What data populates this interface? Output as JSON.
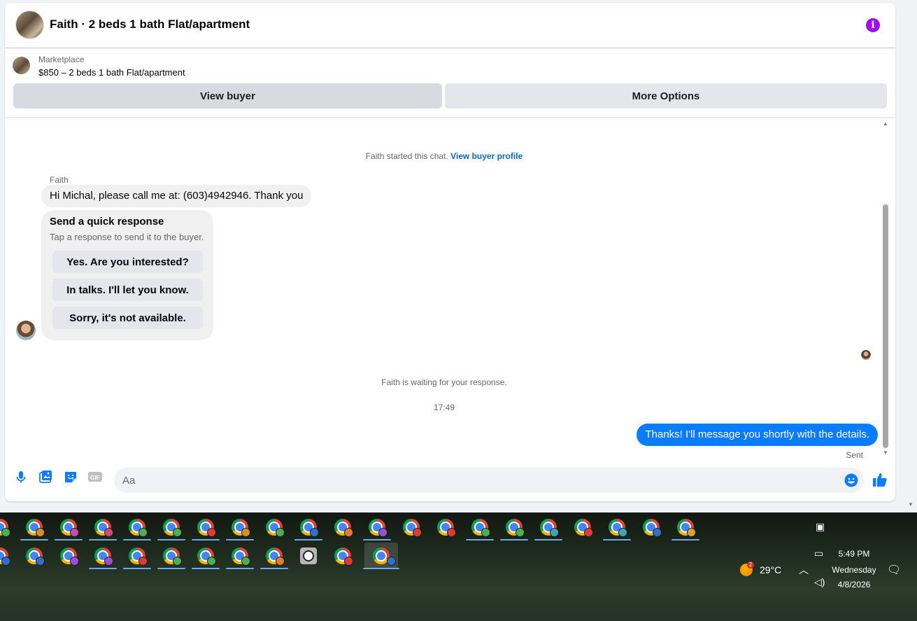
{
  "chat": {
    "title": "Faith · 2 beds 1 bath Flat/apartment",
    "listing_label": "Marketplace",
    "listing_price_title": "$850 – 2 beds 1 bath Flat/apartment",
    "view_buyer_label": "View buyer",
    "more_options_label": "More Options",
    "started_text": "Faith started this chat.",
    "view_profile_link": "View buyer profile",
    "sender_name": "Faith",
    "incoming_message": "Hi Michal, please call me at: (603)4942946. Thank you",
    "quick_response": {
      "title": "Send a quick response",
      "subtitle": "Tap a response to send it to the buyer.",
      "options": [
        "Yes. Are you interested?",
        "In talks. I'll let you know.",
        "Sorry, it's not available."
      ]
    },
    "waiting_text": "Faith is waiting for your response.",
    "timestamp": "17:49",
    "outgoing_message": "Thanks! I'll message you shortly with the details.",
    "sent_status": "Sent",
    "composer_placeholder": "Aa",
    "gif_label": "GIF"
  },
  "taskbar": {
    "weather_temp": "29°C",
    "weather_badge": "2",
    "time": "5:49 PM",
    "day": "Wednesday",
    "date": "4/8/2026"
  },
  "colors": {
    "accent_blue": "#0a7cff",
    "info_purple": "#a10ef2",
    "link_blue": "#0a66d8"
  }
}
